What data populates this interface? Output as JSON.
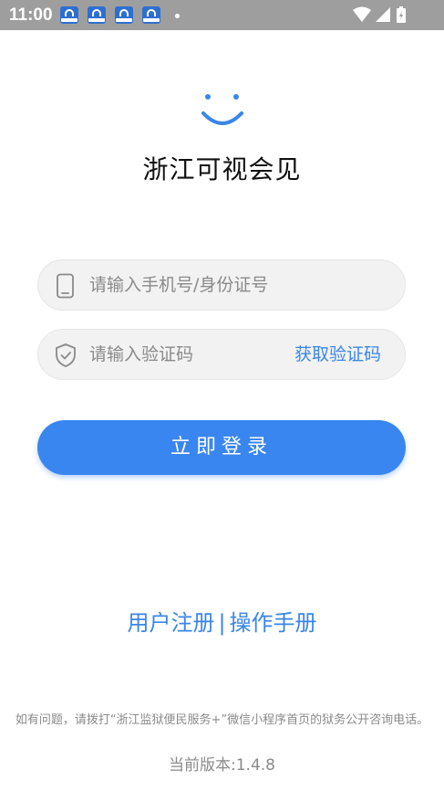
{
  "status_bar": {
    "time": "11:00",
    "notification_icons": [
      "app-notification-icon",
      "app-notification-icon",
      "app-notification-icon",
      "app-notification-icon"
    ],
    "right_icons": [
      "wifi-icon",
      "signal-icon",
      "battery-icon"
    ]
  },
  "app": {
    "logo_icon": "smile-face-logo",
    "title": "浙江可视会见"
  },
  "form": {
    "phone_placeholder": "请输入手机号/身份证号",
    "phone_value": "",
    "code_placeholder": "请输入验证码",
    "code_value": "",
    "get_code_label": "获取验证码",
    "login_label": "立即登录"
  },
  "links": {
    "register": "用户注册",
    "separator": "|",
    "manual": "操作手册"
  },
  "footer": {
    "note": "如有问题，请拨打“浙江监狱便民服务+”微信小程序首页的狱务公开咨询电话。",
    "version": "当前版本:1.4.8"
  },
  "colors": {
    "accent": "#3a86f0",
    "link": "#3a86e8",
    "status_bar": "#9e9e9e"
  }
}
